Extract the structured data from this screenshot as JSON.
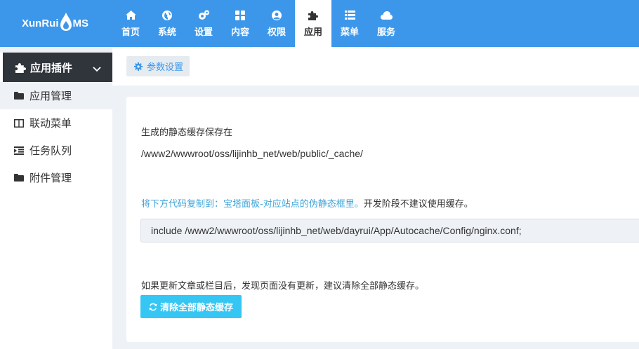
{
  "brand": {
    "logo_left": "XunRui",
    "logo_right": "MS"
  },
  "nav": [
    {
      "label": "首页",
      "icon": "home-icon"
    },
    {
      "label": "系统",
      "icon": "globe-icon"
    },
    {
      "label": "设置",
      "icon": "cogs-icon"
    },
    {
      "label": "内容",
      "icon": "grid-icon"
    },
    {
      "label": "权限",
      "icon": "user-icon"
    },
    {
      "label": "应用",
      "icon": "puzzle-icon",
      "active": true
    },
    {
      "label": "菜单",
      "icon": "list-icon"
    },
    {
      "label": "服务",
      "icon": "cloud-icon"
    }
  ],
  "sidebar": {
    "header": "应用插件",
    "items": [
      {
        "label": "应用管理",
        "icon": "folder-icon",
        "active": true
      },
      {
        "label": "联动菜单",
        "icon": "columns-icon"
      },
      {
        "label": "任务队列",
        "icon": "indent-icon"
      },
      {
        "label": "附件管理",
        "icon": "folder-icon"
      }
    ]
  },
  "tabs": {
    "params": "参数设置"
  },
  "main": {
    "cache_label": "生成的静态缓存保存在",
    "cache_path": "/www2/wwwroot/oss/lijinhb_net/web/public/_cache/",
    "copy_hint_link": "将下方代码复制到：宝塔面板-对应站点的伪静态框里。",
    "copy_hint_rest": "开发阶段不建议使用缓存。",
    "code": "include /www2/wwwroot/oss/lijinhb_net/web/dayrui/App/Autocache/Config/nginx.conf;",
    "clear_hint": "如果更新文章或栏目后，发现页面没有更新，建议清除全部静态缓存。",
    "clear_button": "清除全部静态缓存"
  },
  "colors": {
    "topbar": "#3c97ea",
    "sidebar_header": "#2f353b",
    "link": "#3ba2d8",
    "button": "#36c6f4"
  }
}
